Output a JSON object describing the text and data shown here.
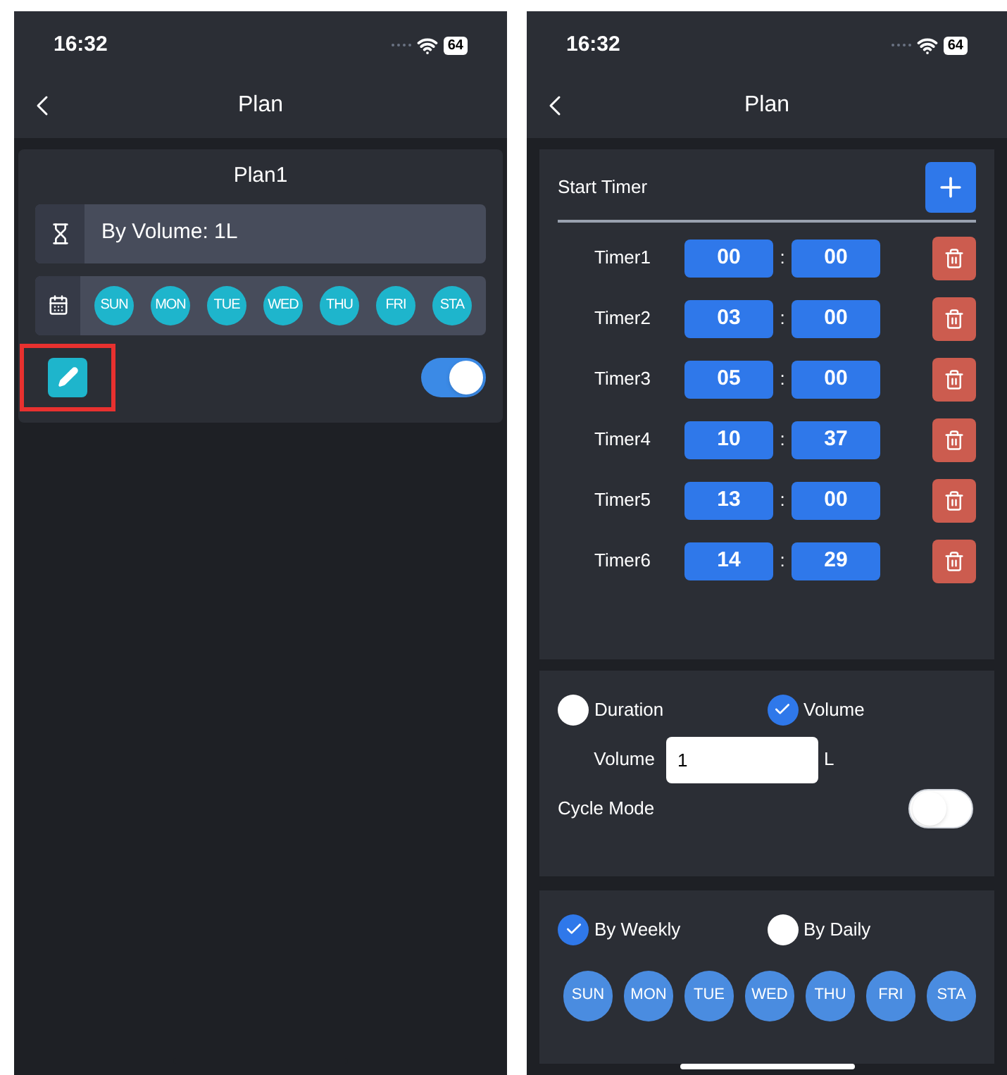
{
  "screens": [
    {
      "status_bar": {
        "time": "16:32",
        "battery": "64"
      },
      "nav": {
        "title": "Plan"
      },
      "plan_card": {
        "title": "Plan1",
        "mode_text": "By Volume: 1L",
        "days": [
          {
            "label": "SUN",
            "selected": true
          },
          {
            "label": "MON",
            "selected": true
          },
          {
            "label": "TUE",
            "selected": true
          },
          {
            "label": "WED",
            "selected": true
          },
          {
            "label": "THU",
            "selected": true
          },
          {
            "label": "FRI",
            "selected": true
          },
          {
            "label": "STA",
            "selected": true
          }
        ],
        "edit_highlighted": true,
        "enabled": true
      }
    },
    {
      "status_bar": {
        "time": "16:32",
        "battery": "64"
      },
      "nav": {
        "title": "Plan"
      },
      "timers": {
        "title": "Start Timer",
        "items": [
          {
            "label": "Timer1",
            "hour": "00",
            "minute": "00"
          },
          {
            "label": "Timer2",
            "hour": "03",
            "minute": "00"
          },
          {
            "label": "Timer3",
            "hour": "05",
            "minute": "00"
          },
          {
            "label": "Timer4",
            "hour": "10",
            "minute": "37"
          },
          {
            "label": "Timer5",
            "hour": "13",
            "minute": "00"
          },
          {
            "label": "Timer6",
            "hour": "14",
            "minute": "29"
          }
        ],
        "separator": ":"
      },
      "mode": {
        "options": [
          {
            "label": "Duration",
            "selected": false
          },
          {
            "label": "Volume",
            "selected": true
          }
        ],
        "field_label": "Volume",
        "value": "1",
        "unit": "L",
        "cycle_label": "Cycle Mode",
        "cycle_on": false
      },
      "schedule": {
        "options": [
          {
            "label": "By Weekly",
            "selected": true
          },
          {
            "label": "By Daily",
            "selected": false
          }
        ],
        "days": [
          {
            "label": "SUN",
            "selected": true
          },
          {
            "label": "MON",
            "selected": true
          },
          {
            "label": "TUE",
            "selected": true
          },
          {
            "label": "WED",
            "selected": true
          },
          {
            "label": "THU",
            "selected": true
          },
          {
            "label": "FRI",
            "selected": true
          },
          {
            "label": "STA",
            "selected": true
          }
        ]
      }
    }
  ]
}
